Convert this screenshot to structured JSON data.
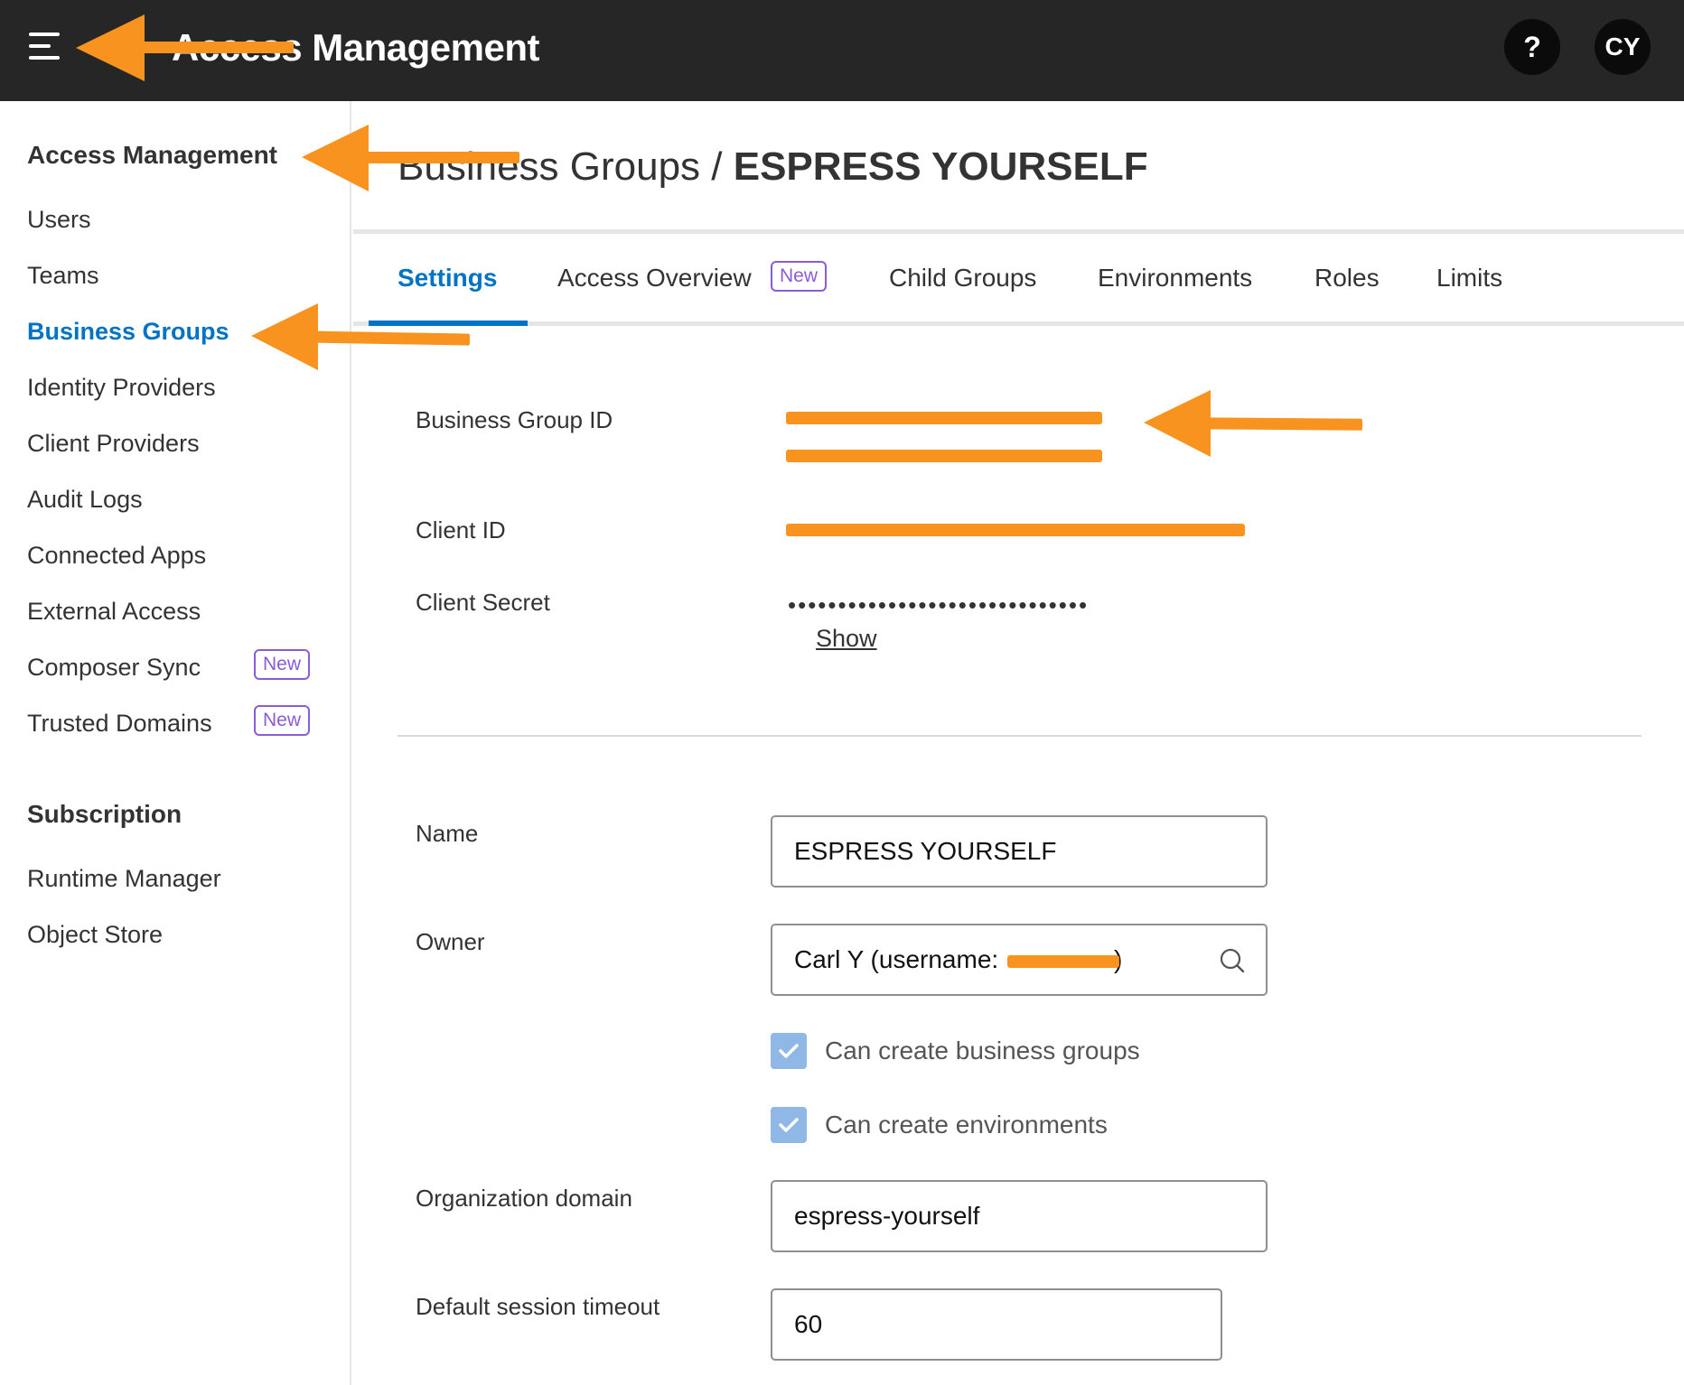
{
  "header": {
    "app_title": "Access Management",
    "help_label": "?",
    "avatar_initials": "CY"
  },
  "sidebar": {
    "section_title": "Access Management",
    "items": [
      {
        "label": "Users"
      },
      {
        "label": "Teams"
      },
      {
        "label": "Business Groups",
        "active": true
      },
      {
        "label": "Identity Providers"
      },
      {
        "label": "Client Providers"
      },
      {
        "label": "Audit Logs"
      },
      {
        "label": "Connected Apps"
      },
      {
        "label": "External Access"
      },
      {
        "label": "Composer Sync",
        "badge": "New"
      },
      {
        "label": "Trusted Domains",
        "badge": "New"
      }
    ],
    "subscription_title": "Subscription",
    "subscription_items": [
      {
        "label": "Runtime Manager"
      },
      {
        "label": "Object Store"
      }
    ]
  },
  "main": {
    "breadcrumb_parent": "Business Groups / ",
    "breadcrumb_current": "ESPRESS YOURSELF",
    "tabs": [
      {
        "label": "Settings",
        "active": true
      },
      {
        "label": "Access Overview",
        "badge": "New"
      },
      {
        "label": "Child Groups"
      },
      {
        "label": "Environments"
      },
      {
        "label": "Roles"
      },
      {
        "label": "Limits"
      }
    ],
    "fields": {
      "business_group_id_label": "Business Group ID",
      "client_id_label": "Client ID",
      "client_secret_label": "Client Secret",
      "client_secret_masked": "••••••••••••••••••••••••••••••",
      "show_link": "Show",
      "name_label": "Name",
      "name_value": "ESPRESS YOURSELF",
      "owner_label": "Owner",
      "owner_value": "Carl Y (username: ",
      "owner_value_end": ")",
      "can_create_business_groups": "Can create business groups",
      "can_create_environments": "Can create environments",
      "org_domain_label": "Organization domain",
      "org_domain_value": "espress-yourself",
      "session_timeout_label": "Default session timeout",
      "session_timeout_value": "60"
    }
  },
  "colors": {
    "topbar": "#262626",
    "accent_blue": "#0073c4",
    "new_badge": "#8a5cd6",
    "annotation_orange": "#f8931f",
    "checkbox_fill": "#8fb8e6"
  }
}
